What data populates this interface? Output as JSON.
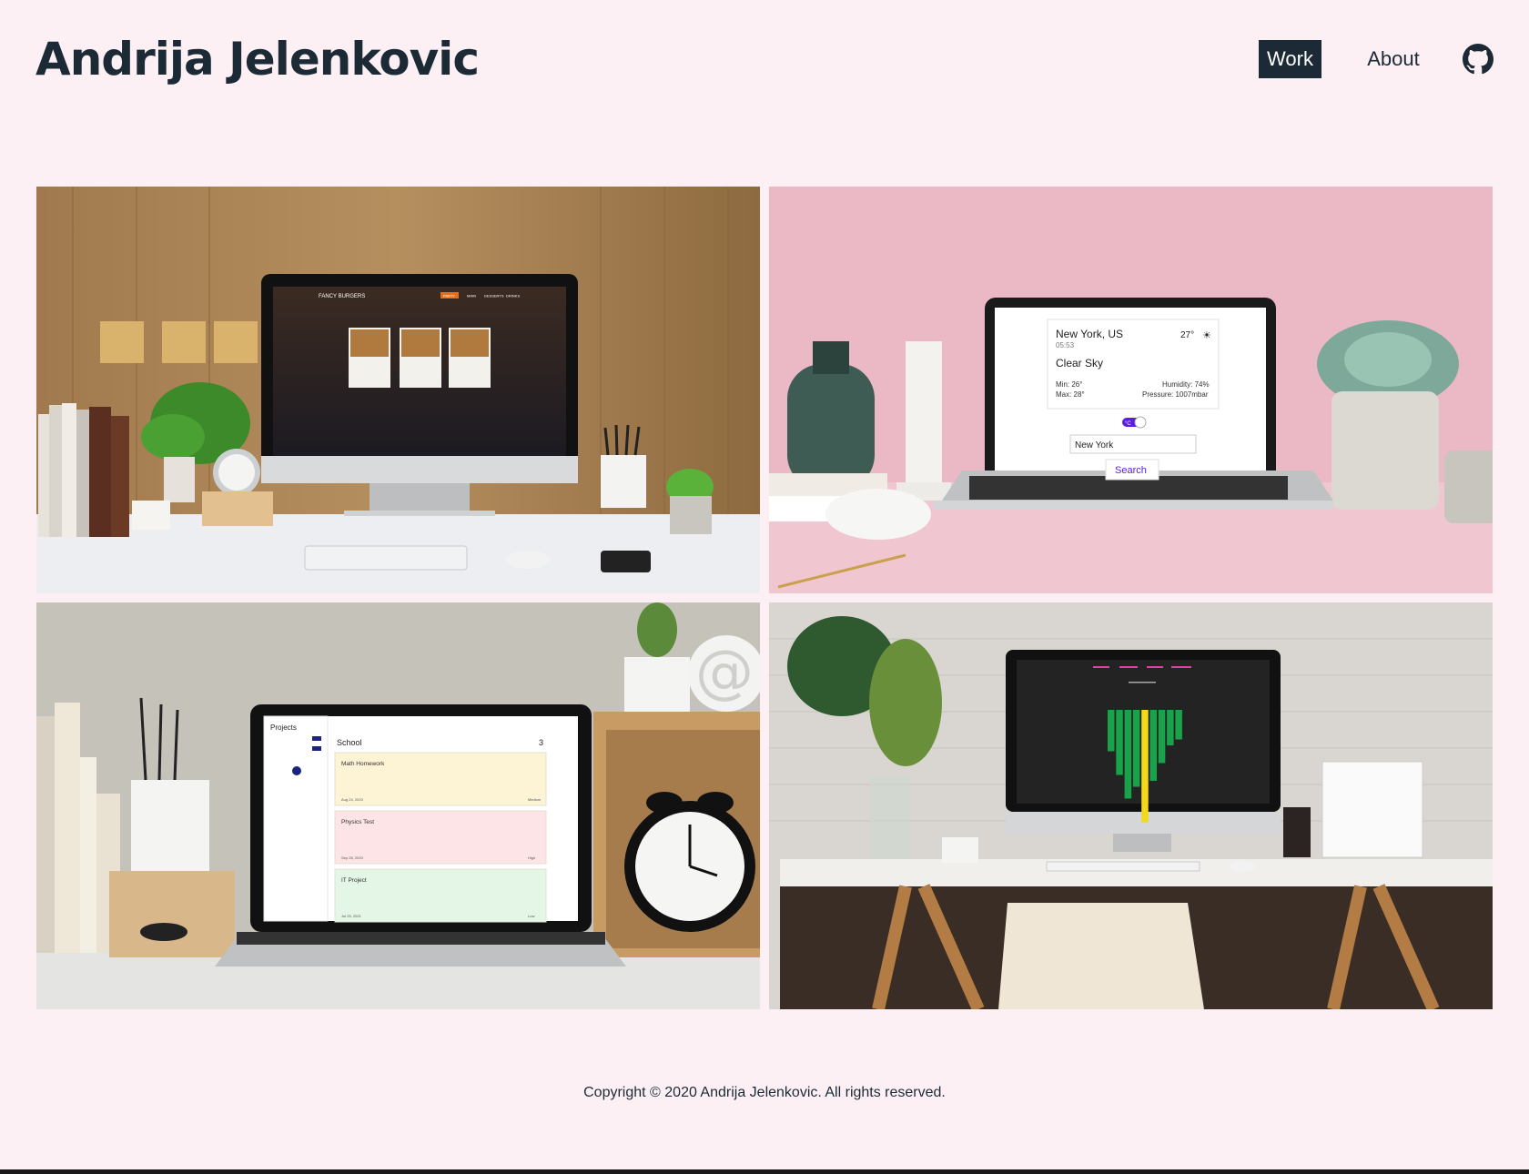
{
  "header": {
    "title": "Andrija Jelenkovic",
    "nav": {
      "work_label": "Work",
      "about_label": "About",
      "github_icon": "github-icon"
    }
  },
  "projects": [
    {
      "screen": {
        "brand": "FANCY BURGERS",
        "nav_items": [
          "PARTY",
          "MAIN",
          "DESSERTS",
          "DRINKS"
        ]
      }
    },
    {
      "screen": {
        "location": "New York, US",
        "time": "05:53",
        "temperature": "27°",
        "condition": "Clear Sky",
        "min": "Min: 26°",
        "max": "Max: 28°",
        "humidity": "Humidity: 74%",
        "pressure": "Pressure: 1007mbar",
        "toggle_label": "°C",
        "search_value": "New York",
        "search_button": "Search"
      }
    },
    {
      "screen": {
        "sidebar_title": "Projects",
        "project_name": "School",
        "project_count": "3",
        "tasks": [
          {
            "title": "Math Homework",
            "date": "Aug 24, 2020",
            "priority": "Medium",
            "color": "#fdf4d6"
          },
          {
            "title": "Physics Test",
            "date": "Sep 28, 2020",
            "priority": "High",
            "color": "#fde4e6"
          },
          {
            "title": "IT Project",
            "date": "Jul 25, 2021",
            "priority": "Low",
            "color": "#e4f6e6"
          }
        ]
      }
    },
    {
      "screen": {
        "bar_levels": [
          0.35,
          0.55,
          0.75,
          0.65,
          0.95,
          0.6,
          0.45,
          0.3,
          0.25
        ],
        "bar_color": "#18a24a",
        "highlight_color": "#f4d81c"
      }
    }
  ],
  "colors": {
    "background": "#fcf0f4",
    "primary": "#1c2a35"
  },
  "footer": {
    "copyright": "Copyright © 2020 Andrija Jelenkovic. All rights reserved."
  }
}
